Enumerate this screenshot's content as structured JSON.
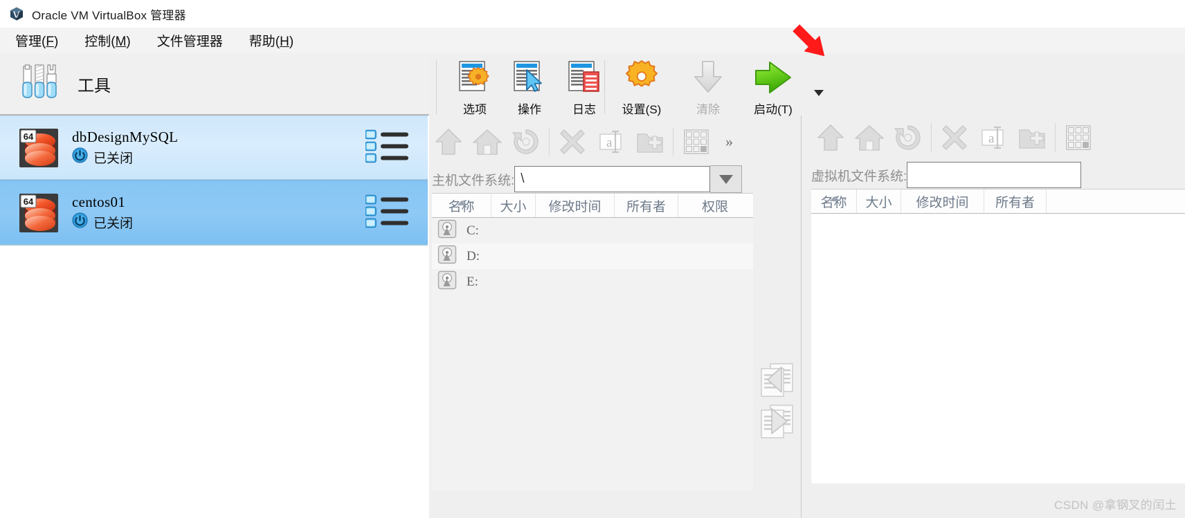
{
  "window": {
    "title": "Oracle VM VirtualBox 管理器",
    "logo_icon": "virtualbox-cube-icon"
  },
  "menubar": {
    "items": [
      {
        "label": "管理(F)",
        "name": "menu-manage"
      },
      {
        "label": "控制(M)",
        "name": "menu-control"
      },
      {
        "label": "文件管理器",
        "name": "menu-file-manager"
      },
      {
        "label": "帮助(H)",
        "name": "menu-help"
      }
    ]
  },
  "sidebar": {
    "tools": {
      "label": "工具",
      "icon": "tools-icon"
    },
    "machines": [
      {
        "name": "dbDesignMySQL",
        "state": "已关闭",
        "arch_badge": "64",
        "state_icon": "power-off-icon",
        "os_icon": "oracle-linux-icon",
        "preview_icon": "vm-details-list-icon",
        "selected": false
      },
      {
        "name": "centos01",
        "state": "已关闭",
        "arch_badge": "64",
        "state_icon": "power-off-icon",
        "os_icon": "oracle-linux-icon",
        "preview_icon": "vm-details-list-icon",
        "selected": true
      }
    ]
  },
  "toolbar": {
    "buttons": [
      {
        "label": "选项",
        "name": "toolbar-preferences",
        "icon": "preferences-gear-page-icon",
        "disabled": false
      },
      {
        "label": "操作",
        "name": "toolbar-operations",
        "icon": "operations-cursor-page-icon",
        "disabled": false
      },
      {
        "label": "日志",
        "name": "toolbar-log",
        "icon": "log-page-icon",
        "disabled": false
      },
      {
        "label": "设置(S)",
        "name": "toolbar-settings",
        "icon": "gear-icon",
        "disabled": false
      },
      {
        "label": "清除",
        "name": "toolbar-discard",
        "icon": "down-arrow-icon",
        "disabled": true
      },
      {
        "label": "启动(T)",
        "name": "toolbar-start",
        "icon": "green-right-arrow-icon",
        "disabled": false
      }
    ],
    "start_dropdown_icon": "chevron-down-icon"
  },
  "file_manager": {
    "host": {
      "path_label": "主机文件系统:",
      "path_value": "\\",
      "combo_icon": "chevron-down-icon",
      "toolbar_icons": [
        {
          "name": "go-up-icon"
        },
        {
          "name": "go-home-icon"
        },
        {
          "name": "refresh-icon"
        },
        {
          "name": "delete-icon"
        },
        {
          "name": "rename-icon"
        },
        {
          "name": "new-folder-icon"
        },
        {
          "name": "properties-grid-icon"
        }
      ],
      "overflow_label": "»",
      "columns": [
        "名称",
        "大小",
        "修改时间",
        "所有者",
        "权限"
      ],
      "sort_column": "名称",
      "sort_direction": "ascending",
      "rows": [
        {
          "name": "C:",
          "size": "",
          "modified": "",
          "owner": "",
          "permissions": "",
          "icon": "hard-drive-icon"
        },
        {
          "name": "D:",
          "size": "",
          "modified": "",
          "owner": "",
          "permissions": "",
          "icon": "hard-drive-icon"
        },
        {
          "name": "E:",
          "size": "",
          "modified": "",
          "owner": "",
          "permissions": "",
          "icon": "hard-drive-icon"
        }
      ]
    },
    "guest": {
      "path_label": "虚拟机文件系统:",
      "path_value": "",
      "toolbar_icons": [
        {
          "name": "go-up-icon"
        },
        {
          "name": "go-home-icon"
        },
        {
          "name": "refresh-icon"
        },
        {
          "name": "delete-icon"
        },
        {
          "name": "rename-icon"
        },
        {
          "name": "new-folder-icon"
        },
        {
          "name": "properties-grid-icon"
        }
      ],
      "columns": [
        "名称",
        "大小",
        "修改时间",
        "所有者"
      ],
      "sort_column": "名称",
      "sort_direction": "ascending",
      "rows": []
    },
    "transfer": {
      "copy_to_host_icon": "copy-left-icon",
      "copy_to_guest_icon": "copy-right-icon"
    }
  },
  "annotation": {
    "arrow_icon": "red-pointer-arrow",
    "arrow_color": "#ff1a1a",
    "points_to": "toolbar-start"
  },
  "watermark": {
    "text": "CSDN @拿钢叉的闰土"
  },
  "colors": {
    "selection_strong": "#86c5f4",
    "selection_light": "#cfe7fa",
    "start_green": "#5fce1f",
    "accent_orange": "#f5a623",
    "header_text": "#6d7a8a"
  }
}
